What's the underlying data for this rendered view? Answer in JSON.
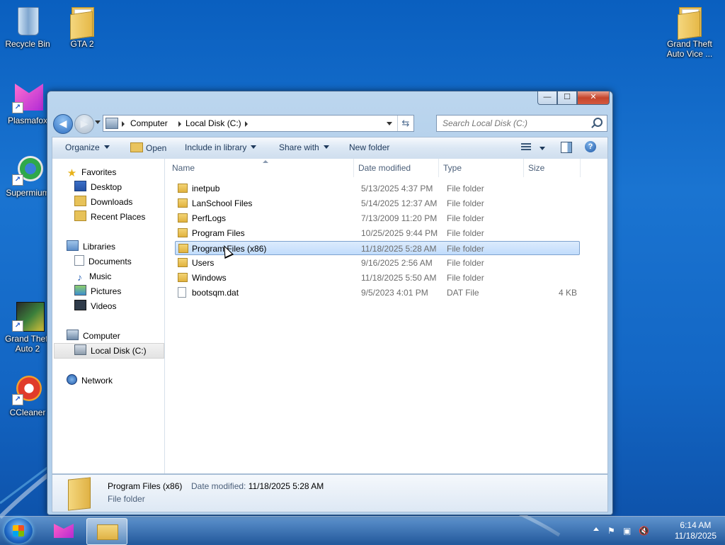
{
  "desktop": {
    "icons": [
      {
        "label": "Recycle Bin"
      },
      {
        "label": "GTA 2"
      },
      {
        "label": "Plasmafox"
      },
      {
        "label": "Supermium"
      },
      {
        "label": "Grand Theft Auto 2"
      },
      {
        "label": "CCleaner"
      },
      {
        "label": "Grand Theft Auto Vice ..."
      }
    ]
  },
  "window": {
    "controls": {
      "minimize": "—",
      "maximize": "☐",
      "close": "✕"
    },
    "address": {
      "crumbs": [
        "Computer",
        "Local Disk (C:)"
      ]
    },
    "search": {
      "placeholder": "Search Local Disk (C:)"
    },
    "toolbar": {
      "organize": "Organize",
      "open": "Open",
      "include_in_library": "Include in library",
      "share_with": "Share with",
      "new_folder": "New folder",
      "help": "?"
    },
    "navpane": {
      "favorites": "Favorites",
      "desktop": "Desktop",
      "downloads": "Downloads",
      "recent_places": "Recent Places",
      "libraries": "Libraries",
      "documents": "Documents",
      "music": "Music",
      "pictures": "Pictures",
      "videos": "Videos",
      "computer": "Computer",
      "local_disk": "Local Disk (C:)",
      "network": "Network"
    },
    "columns": {
      "name": "Name",
      "date_modified": "Date modified",
      "type": "Type",
      "size": "Size"
    },
    "files": [
      {
        "name": "inetpub",
        "date": "5/13/2025 4:37 PM",
        "type": "File folder",
        "size": ""
      },
      {
        "name": "LanSchool Files",
        "date": "5/14/2025 12:37 AM",
        "type": "File folder",
        "size": ""
      },
      {
        "name": "PerfLogs",
        "date": "7/13/2009 11:20 PM",
        "type": "File folder",
        "size": ""
      },
      {
        "name": "Program Files",
        "date": "10/25/2025 9:44 PM",
        "type": "File folder",
        "size": ""
      },
      {
        "name": "Program Files (x86)",
        "date": "11/18/2025 5:28 AM",
        "type": "File folder",
        "size": ""
      },
      {
        "name": "Users",
        "date": "9/16/2025 2:56 AM",
        "type": "File folder",
        "size": ""
      },
      {
        "name": "Windows",
        "date": "11/18/2025 5:50 AM",
        "type": "File folder",
        "size": ""
      },
      {
        "name": "bootsqm.dat",
        "date": "9/5/2023 4:01 PM",
        "type": "DAT File",
        "size": "4 KB"
      }
    ],
    "details": {
      "name": "Program Files (x86)",
      "date_modified_label": "Date modified:",
      "date_modified": "11/18/2025 5:28 AM",
      "type": "File folder"
    }
  },
  "taskbar": {
    "clock_time": "6:14 AM",
    "clock_date": "11/18/2025"
  }
}
